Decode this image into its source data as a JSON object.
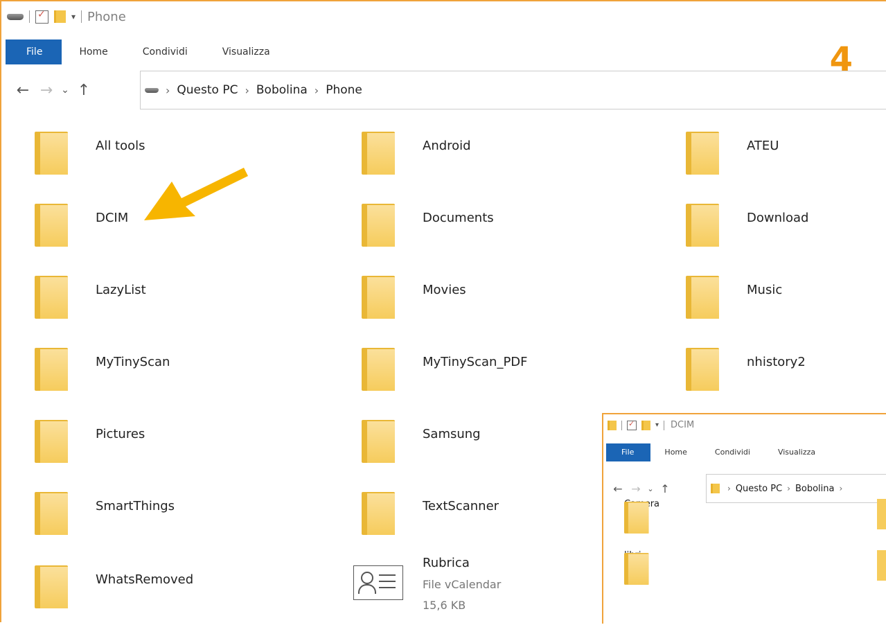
{
  "window": {
    "title": "Phone",
    "tabs": [
      "File",
      "Home",
      "Condividi",
      "Visualizza"
    ],
    "step_number": "4",
    "breadcrumb": [
      "Questo PC",
      "Bobolina",
      "Phone"
    ]
  },
  "items": [
    {
      "name": "All tools",
      "type": "folder"
    },
    {
      "name": "Android",
      "type": "folder"
    },
    {
      "name": "ATEU",
      "type": "folder"
    },
    {
      "name": "DCIM",
      "type": "folder"
    },
    {
      "name": "Documents",
      "type": "folder"
    },
    {
      "name": "Download",
      "type": "folder"
    },
    {
      "name": "LazyList",
      "type": "folder"
    },
    {
      "name": "Movies",
      "type": "folder"
    },
    {
      "name": "Music",
      "type": "folder"
    },
    {
      "name": "MyTinyScan",
      "type": "folder"
    },
    {
      "name": "MyTinyScan_PDF",
      "type": "folder"
    },
    {
      "name": "nhistory2",
      "type": "folder"
    },
    {
      "name": "Pictures",
      "type": "folder"
    },
    {
      "name": "Samsung",
      "type": "folder"
    },
    {
      "name": "SmartThings",
      "type": "folder"
    },
    {
      "name": "TextScanner",
      "type": "folder"
    },
    {
      "name": "WhatsRemoved",
      "type": "folder"
    },
    {
      "name": "Rubrica",
      "type": "file",
      "filetype": "File vCalendar",
      "size": "15,6 KB"
    }
  ],
  "inset": {
    "title": "DCIM",
    "tabs": [
      "File",
      "Home",
      "Condividi",
      "Visualizza"
    ],
    "breadcrumb": [
      "Questo PC",
      "Bobolina"
    ],
    "items": [
      "Camera",
      "libri"
    ]
  },
  "colors": {
    "accent": "#f0a33a",
    "file_tab": "#1b65b5",
    "folder": "#f6cc5c",
    "arrow": "#f7b500",
    "step": "#f0960f"
  }
}
